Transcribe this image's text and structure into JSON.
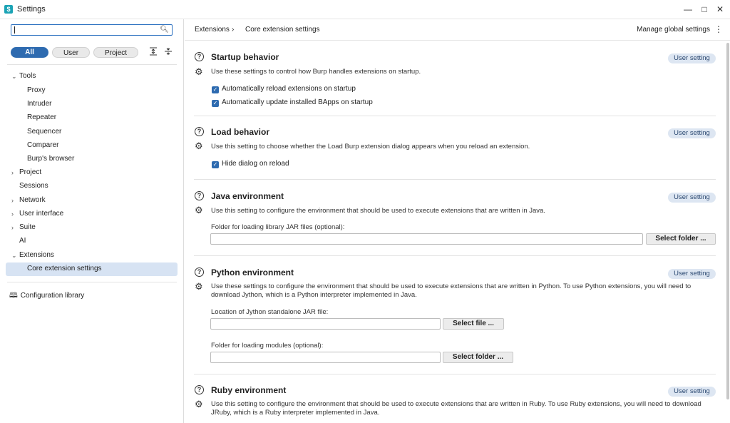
{
  "window": {
    "title": "Settings",
    "minimize": "—",
    "maximize": "□",
    "close": "✕"
  },
  "sidebar": {
    "search_placeholder": "",
    "scopes": [
      "All",
      "User",
      "Project"
    ],
    "tree": {
      "tools": "Tools",
      "proxy": "Proxy",
      "intruder": "Intruder",
      "repeater": "Repeater",
      "sequencer": "Sequencer",
      "comparer": "Comparer",
      "burps_browser": "Burp's browser",
      "project": "Project",
      "sessions": "Sessions",
      "network": "Network",
      "user_interface": "User interface",
      "suite": "Suite",
      "ai": "AI",
      "extensions": "Extensions",
      "core_extension_settings": "Core extension settings"
    },
    "config_library": "Configuration library"
  },
  "header": {
    "breadcrumb_1": "Extensions",
    "breadcrumb_sep": "›",
    "breadcrumb_2": "Core extension settings",
    "manage": "Manage global settings"
  },
  "badge_label": "User setting",
  "sections": {
    "startup": {
      "title": "Startup behavior",
      "desc": "Use these settings to control how Burp handles extensions on startup.",
      "check1": "Automatically reload extensions on startup",
      "check2": "Automatically update installed BApps on startup"
    },
    "load": {
      "title": "Load behavior",
      "desc": "Use this setting to choose whether the Load Burp extension dialog appears when you reload an extension.",
      "check1": "Hide dialog on reload"
    },
    "java": {
      "title": "Java environment",
      "desc": "Use this setting to configure the environment that should be used to execute extensions that are written in Java.",
      "field_label": "Folder for loading library JAR files (optional):",
      "button": "Select folder ..."
    },
    "python": {
      "title": "Python environment",
      "desc1": "Use these settings to configure the environment that should be used to execute extensions that are written in Python. To use Python extensions, you will need to",
      "desc2": "download Jython, which is a Python interpreter implemented in Java.",
      "field1_label": "Location of Jython standalone JAR file:",
      "button1": "Select file ...",
      "field2_label": "Folder for loading modules (optional):",
      "button2": "Select folder ..."
    },
    "ruby": {
      "title": "Ruby environment",
      "desc1": "Use this setting to configure the environment that should be used to execute extensions that are written in Ruby. To use Ruby extensions, you will need to download",
      "desc2": "JRuby, which is a Ruby interpreter implemented in Java."
    }
  }
}
